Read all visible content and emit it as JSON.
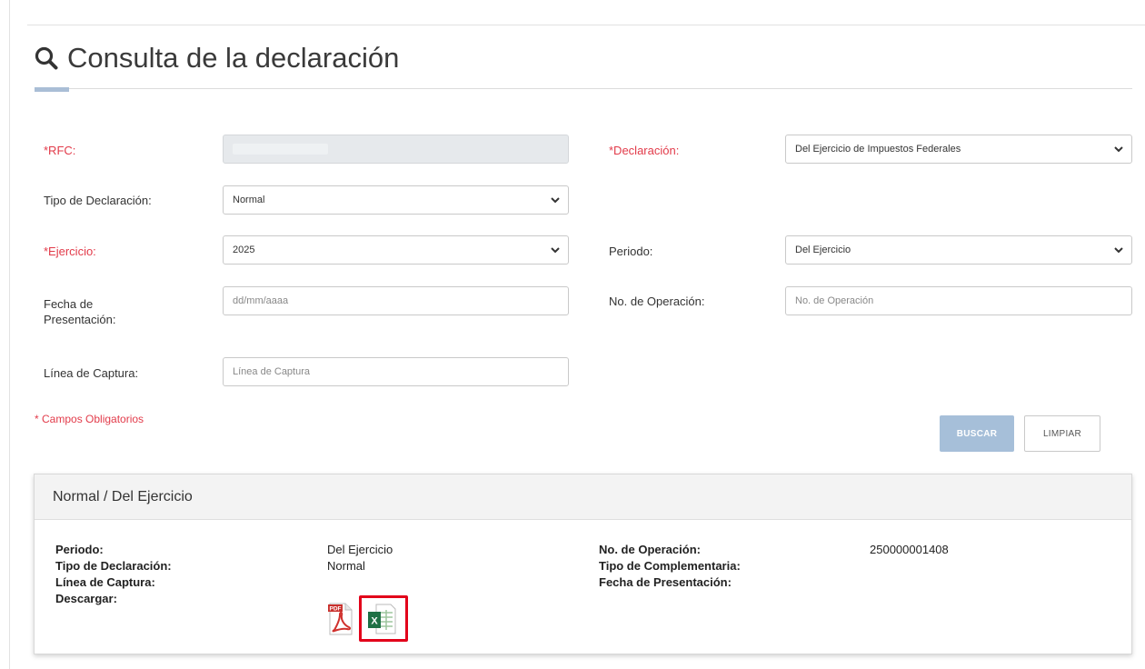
{
  "page": {
    "title": "Consulta de la declaración"
  },
  "form": {
    "rfc_label": "*RFC:",
    "rfc_value": "",
    "declaracion_label": "*Declaración:",
    "declaracion_value": "Del Ejercicio de Impuestos Federales",
    "tipo_label": "Tipo de Declaración:",
    "tipo_value": "Normal",
    "ejercicio_label": "*Ejercicio:",
    "ejercicio_value": "2025",
    "periodo_label": "Periodo:",
    "periodo_value": "Del Ejercicio",
    "fecha_label": "Fecha de Presentación:",
    "fecha_placeholder": "dd/mm/aaaa",
    "operacion_label": "No. de Operación:",
    "operacion_placeholder": "No. de Operación",
    "linea_label": "Línea de Captura:",
    "linea_placeholder": "Línea de Captura",
    "required_note": "* Campos Obligatorios",
    "buscar_label": "BUSCAR",
    "limpiar_label": "LIMPIAR"
  },
  "result": {
    "header": "Normal / Del Ejercicio",
    "periodo_label": "Periodo:",
    "periodo_value": "Del Ejercicio",
    "tipo_label": "Tipo de Declaración:",
    "tipo_value": "Normal",
    "linea_label": "Línea de Captura:",
    "descargar_label": "Descargar:",
    "operacion_label": "No. de Operación:",
    "operacion_value": "250000001408",
    "complementaria_label": "Tipo de Complementaria:",
    "fecha_label": "Fecha de Presentación:",
    "pdf_text": "PDF",
    "excel_text": "X"
  },
  "colors": {
    "required": "#e23b4a",
    "primary_button": "#a6bfd9",
    "highlight": "#e2001a"
  },
  "icons": {
    "title": "search-icon",
    "dropdown": "chevron-down-icon",
    "pdf": "pdf-icon",
    "excel": "excel-icon"
  }
}
